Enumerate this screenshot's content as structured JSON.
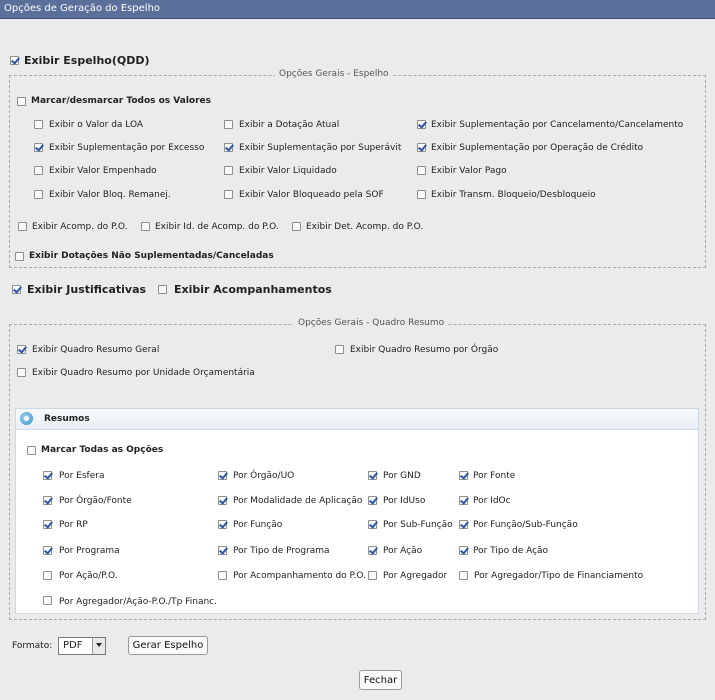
{
  "window": {
    "title": "Opções de Geração do Espelho"
  },
  "exibir_espelho": {
    "label": "Exibir Espelho(QDD)",
    "checked": true
  },
  "opcoes_gerais_espelho": {
    "legend": "Opções Gerais - Espelho",
    "marcar_todos": {
      "label": "Marcar/desmarcar Todos os Valores",
      "checked": false
    },
    "valores": [
      {
        "label": "Exibir o Valor da LOA",
        "checked": false
      },
      {
        "label": "Exibir a Dotação Atual",
        "checked": false
      },
      {
        "label": "Exibir Suplementação por Cancelamento/Cancelamento",
        "checked": true
      },
      {
        "label": "Exibir Suplementação por Excesso",
        "checked": true
      },
      {
        "label": "Exibir Suplementação por Superávit",
        "checked": true
      },
      {
        "label": "Exibir Suplementação por Operação de Crédito",
        "checked": true
      },
      {
        "label": "Exibir Valor Empenhado",
        "checked": false
      },
      {
        "label": "Exibir Valor Liquidado",
        "checked": false
      },
      {
        "label": "Exibir Valor Pago",
        "checked": false
      },
      {
        "label": "Exibir Valor Bloq. Remanej.",
        "checked": false
      },
      {
        "label": "Exibir Valor Bloqueado pela SOF",
        "checked": false
      },
      {
        "label": "Exibir Transm. Bloqueio/Desbloqueio",
        "checked": false
      }
    ],
    "acompanhamentos": [
      {
        "label": "Exibir Acomp. do P.O.",
        "checked": false
      },
      {
        "label": "Exibir Id. de Acomp. do P.O.",
        "checked": false
      },
      {
        "label": "Exibir Det. Acomp. do P.O.",
        "checked": false
      }
    ],
    "dotacoes_nao_suplementadas": {
      "label": "Exibir Dotações Não Suplementadas/Canceladas",
      "checked": false
    }
  },
  "exibir_justificativas": {
    "label": "Exibir Justificativas",
    "checked": true
  },
  "exibir_acompanhamentos": {
    "label": "Exibir Acompanhamentos",
    "checked": false
  },
  "quadro_resumo": {
    "legend": "Opções Gerais - Quadro Resumo",
    "opcoes": [
      {
        "label": "Exibir Quadro Resumo Geral",
        "checked": true
      },
      {
        "label": "Exibir Quadro Resumo por Órgão",
        "checked": false
      },
      {
        "label": "Exibir Quadro Resumo por Unidade Orçamentária",
        "checked": false
      }
    ],
    "resumos": {
      "title": "Resumos",
      "marcar_todas": {
        "label": "Marcar Todas as Opções",
        "checked": false
      },
      "itens": [
        {
          "label": "Por Esfera",
          "checked": true
        },
        {
          "label": "Por Órgão/UO",
          "checked": true
        },
        {
          "label": "Por GND",
          "checked": true
        },
        {
          "label": "Por Fonte",
          "checked": true
        },
        {
          "label": "Por Órgão/Fonte",
          "checked": true
        },
        {
          "label": "Por Modalidade de Aplicação",
          "checked": true
        },
        {
          "label": "Por IdUso",
          "checked": true
        },
        {
          "label": "Por IdOc",
          "checked": true
        },
        {
          "label": "Por RP",
          "checked": true
        },
        {
          "label": "Por Função",
          "checked": true
        },
        {
          "label": "Por Sub-Função",
          "checked": true
        },
        {
          "label": "Por Função/Sub-Função",
          "checked": true
        },
        {
          "label": "Por Programa",
          "checked": true
        },
        {
          "label": "Por Tipo de Programa",
          "checked": true
        },
        {
          "label": "Por Ação",
          "checked": true
        },
        {
          "label": "Por Tipo de Ação",
          "checked": true
        },
        {
          "label": "Por Ação/P.O.",
          "checked": false
        },
        {
          "label": "Por Acompanhamento do P.O.",
          "checked": false
        },
        {
          "label": "Por Agregador",
          "checked": false
        },
        {
          "label": "Por Agregador/Tipo de Financiamento",
          "checked": false
        },
        {
          "label": "Por Agregador/Ação-P.O./Tp Financ.",
          "checked": false
        }
      ]
    }
  },
  "formato": {
    "label": "Formato:",
    "value": "PDF"
  },
  "buttons": {
    "gerar": "Gerar Espelho",
    "fechar": "Fechar"
  }
}
